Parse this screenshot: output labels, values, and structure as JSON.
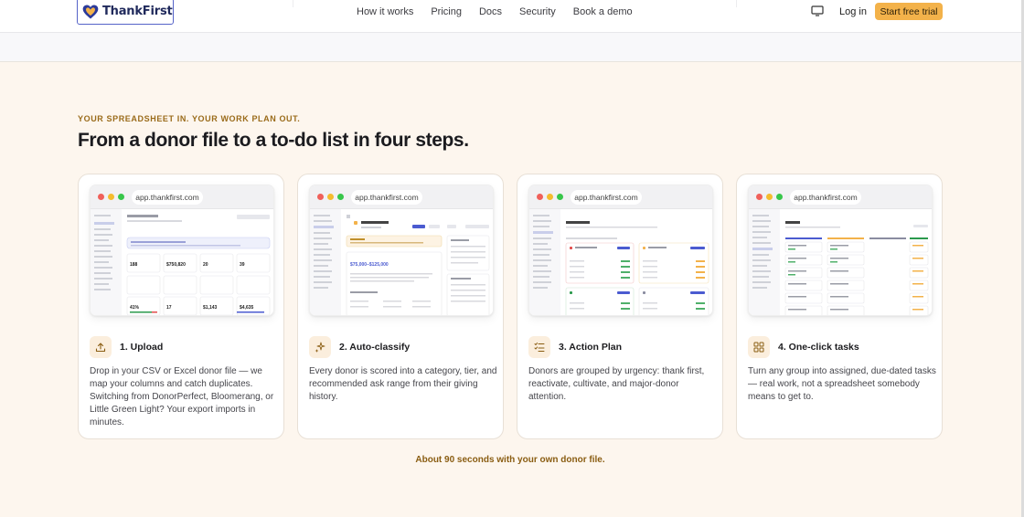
{
  "header": {
    "brand": "ThankFirst",
    "nav": [
      "How it works",
      "Pricing",
      "Docs",
      "Security",
      "Book a demo"
    ],
    "login": "Log in",
    "cta": "Start free trial"
  },
  "section": {
    "eyebrow": "YOUR SPREADSHEET IN. YOUR WORK PLAN OUT.",
    "title": "From a donor file to a to-do list in four steps.",
    "footnote": "About 90 seconds with your own donor file."
  },
  "steps": [
    {
      "url": "app.thankfirst.com",
      "icon": "upload-icon",
      "title": "1. Upload",
      "description": "Drop in your CSV or Excel donor file — we map your columns and catch duplicates. Switching from DonorPerfect, Bloomerang, or Little Green Light? Your export imports in minutes.",
      "preview": {
        "kpis": [
          "188",
          "$750,820",
          "20",
          "39",
          "41%",
          "17",
          "$1,143",
          "$4,635"
        ]
      }
    },
    {
      "url": "app.thankfirst.com",
      "icon": "sparkle-icon",
      "title": "2. Auto-classify",
      "description": "Every donor is scored into a category, tier, and recommended ask range from their giving history.",
      "preview": {
        "ask_range": "$75,000–$125,000"
      }
    },
    {
      "url": "app.thankfirst.com",
      "icon": "checklist-icon",
      "title": "3. Action Plan",
      "description": "Donors are grouped by urgency: thank first, reactivate, cultivate, and major-donor attention.",
      "preview": {}
    },
    {
      "url": "app.thankfirst.com",
      "icon": "grid-icon",
      "title": "4. One-click tasks",
      "description": "Turn any group into assigned, due-dated tasks — real work, not a spreadsheet somebody means to get to.",
      "preview": {}
    }
  ],
  "colors": {
    "background": "#fdf6ee",
    "accent": "#f3b24a",
    "eyebrow": "#9a6b1a",
    "brand_outline": "#5563c8"
  }
}
